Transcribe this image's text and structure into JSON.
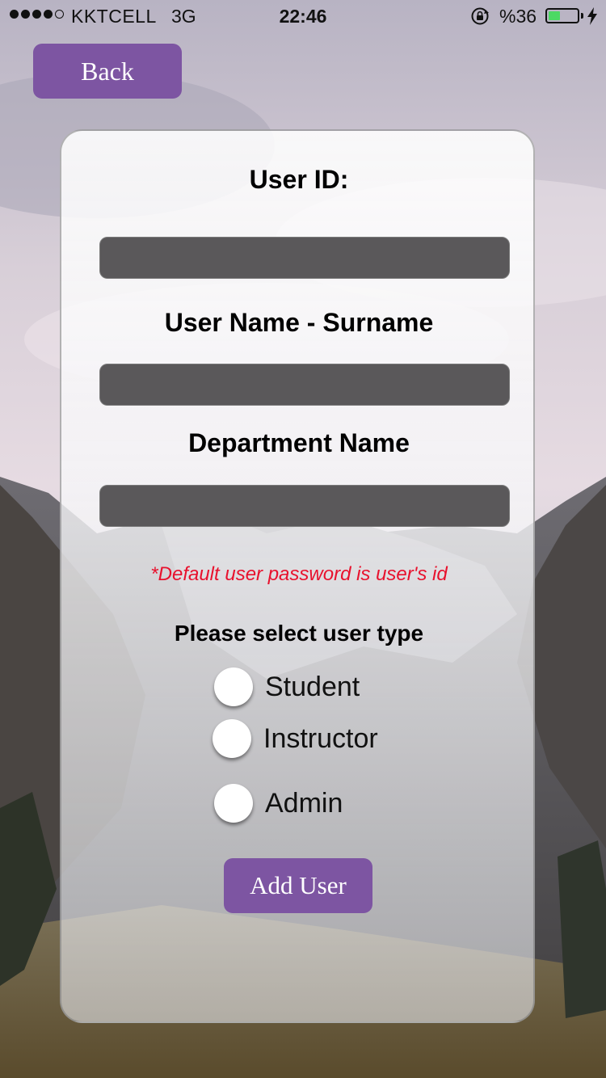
{
  "status_bar": {
    "carrier": "KKTCELL",
    "network": "3G",
    "time": "22:46",
    "battery_percent": "%36",
    "battery_level": 0.36,
    "signal_bars": 4
  },
  "header": {
    "back_label": "Back"
  },
  "form": {
    "user_id_label": "User ID:",
    "user_id_value": "",
    "name_label": "User Name - Surname",
    "name_value": "",
    "department_label": "Department Name",
    "department_value": "",
    "password_note": "*Default user password is user's id",
    "user_type_prompt": "Please select user type",
    "user_types": [
      "Student",
      "Instructor",
      "Admin"
    ],
    "submit_label": "Add User"
  },
  "colors": {
    "accent": "#7d55a2",
    "note": "#e8112d",
    "input_bg": "#5a585a",
    "battery": "#4cd964"
  },
  "icons": [
    "rotation-lock-icon",
    "battery-icon",
    "charging-bolt-icon",
    "signal-icon"
  ]
}
